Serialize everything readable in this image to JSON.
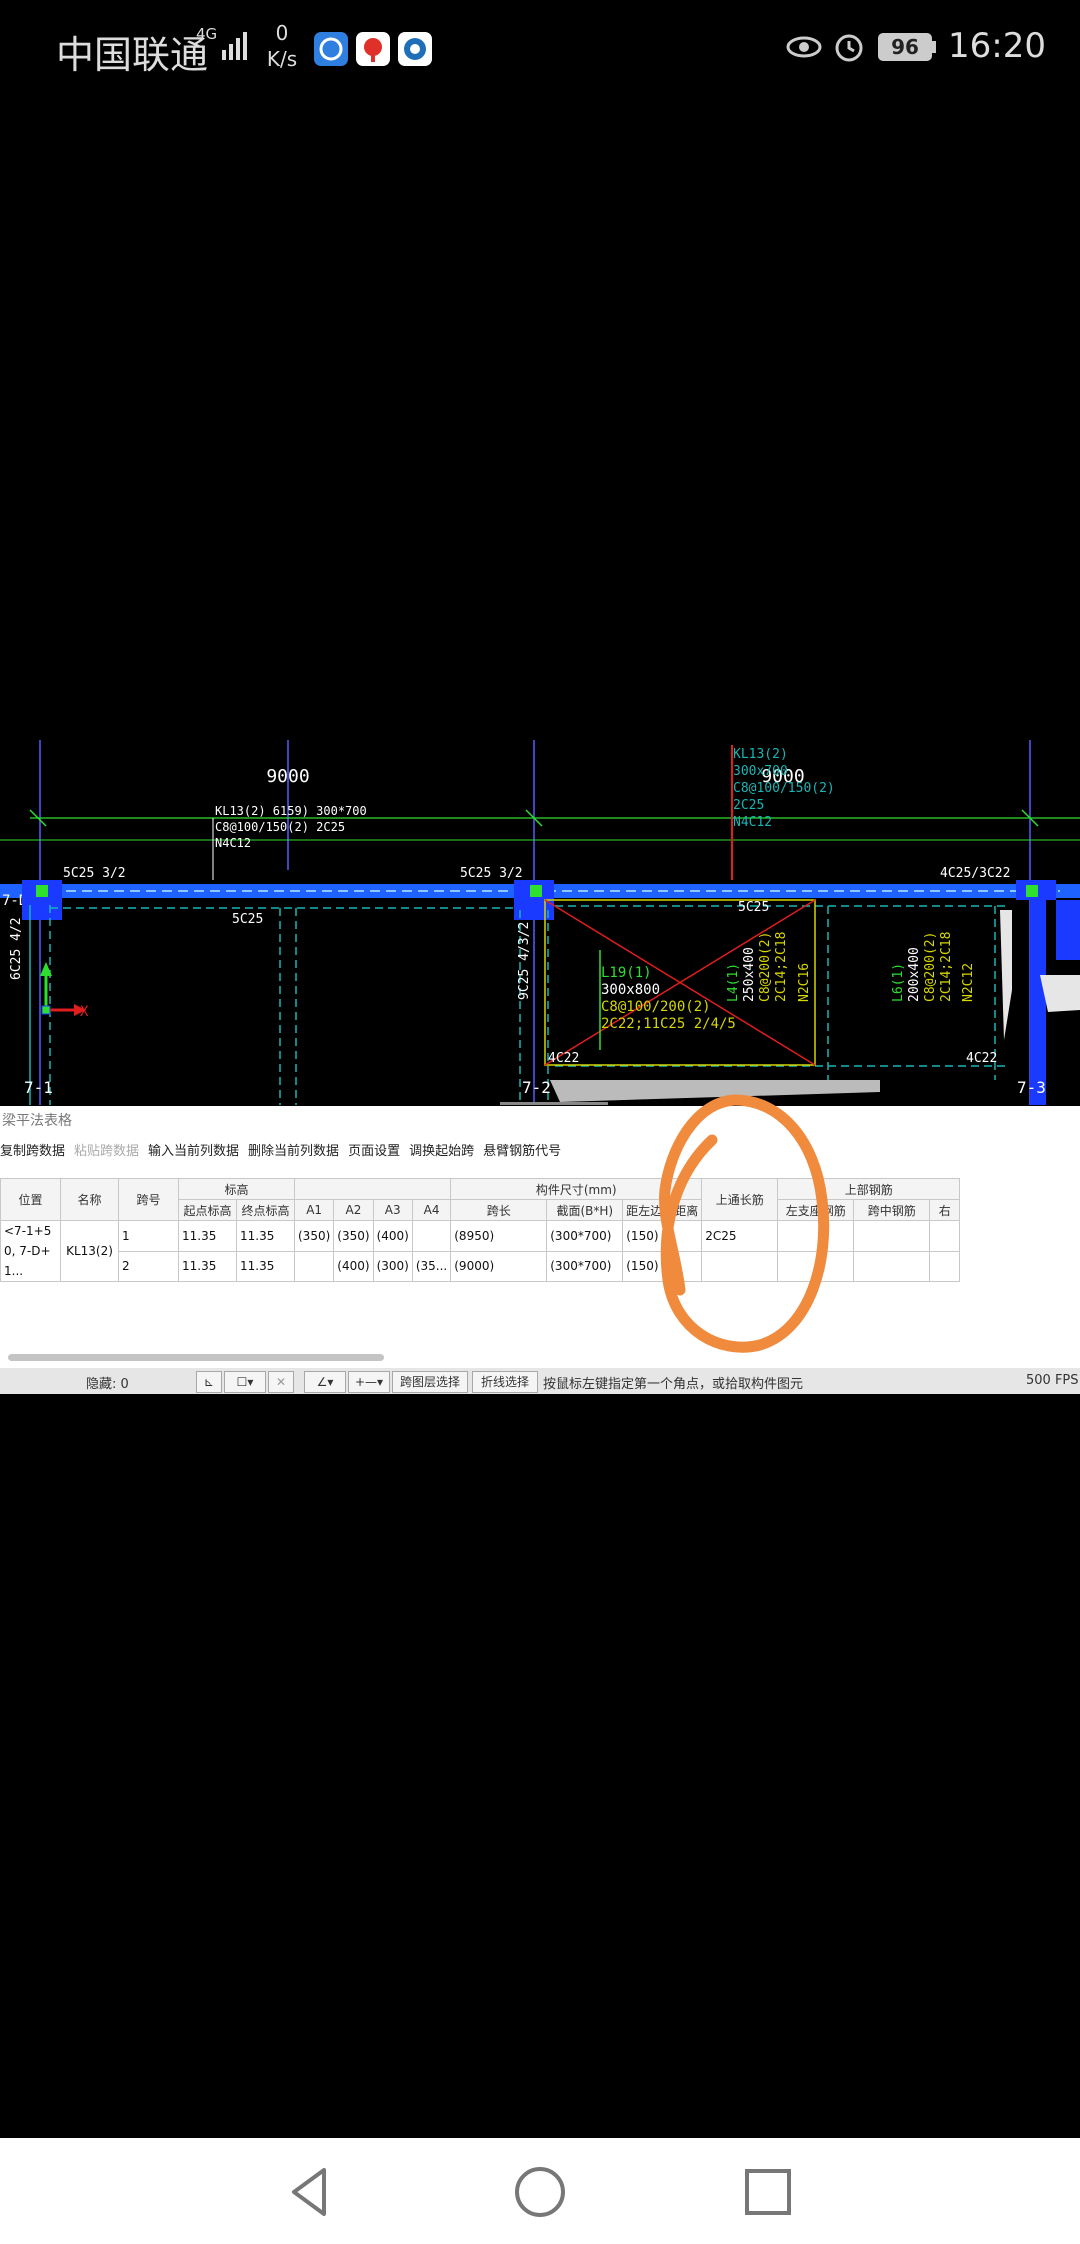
{
  "status_bar": {
    "carrier": "中国联通",
    "network": "4G",
    "speed_value": "0",
    "speed_unit": "K/s",
    "battery": "96",
    "time": "16:20"
  },
  "cad": {
    "top_span_1": "9000",
    "top_span_2": "9000",
    "beam_note_1": "KL13(2) 6159) 300*700",
    "beam_note_2": "C8@100/150(2) 2C25",
    "beam_note_3": "N4C12",
    "green_note_1": "KL13(2)",
    "green_note_2": "300x700",
    "green_note_3": "C8@100/150(2)",
    "green_note_4": "2C25",
    "green_note_5": "N4C12",
    "left_label": "7-D",
    "rebar_top_1": "5C25 3/2",
    "rebar_top_2": "5C25 3/2",
    "rebar_top_3": "4C25/3C22",
    "rebar_bot_1": "5C25",
    "rebar_bot_2": "5C25",
    "side_rebar_1": "6C25 4/2",
    "side_rebar_2": "9C25 4/3/2",
    "l19_1": "L19(1)",
    "l19_2": "300x800",
    "l19_3": "C8@100/200(2)",
    "l19_4": "2C22;11C25 2/4/5",
    "l4_1": "L4(1)",
    "l4_2": "250x400",
    "l4_3": "C8@200(2)",
    "l4_4": "2C14;2C18",
    "l4_5": "N2C16",
    "l6_1": "L6(1)",
    "l6_2": "200x400",
    "l6_3": "C8@200(2)",
    "l6_4": "2C14;2C18",
    "l6_5": "N2C12",
    "corner_1": "4C22",
    "corner_2": "4C22",
    "axis_x": "X",
    "axis_1": "7-1",
    "axis_2": "7-2",
    "axis_3": "7-3"
  },
  "panel": {
    "title": "梁平法表格",
    "toolbar": [
      {
        "label": "复制跨数据",
        "enabled": true
      },
      {
        "label": "粘贴跨数据",
        "enabled": false
      },
      {
        "label": "输入当前列数据",
        "enabled": true
      },
      {
        "label": "删除当前列数据",
        "enabled": true
      },
      {
        "label": "页面设置",
        "enabled": true
      },
      {
        "label": "调换起始跨",
        "enabled": true
      },
      {
        "label": "悬臂钢筋代号",
        "enabled": true
      }
    ],
    "headers": {
      "position": "位置",
      "name": "名称",
      "span_no": "跨号",
      "elevation": "标高",
      "start_elev": "起点标高",
      "end_elev": "终点标高",
      "a1": "A1",
      "a2": "A2",
      "a3": "A3",
      "a4": "A4",
      "dims": "构件尺寸(mm)",
      "span_len": "跨长",
      "section": "截面(B*H)",
      "edge_dist": "距左边线距离",
      "through_bar": "上通长筋",
      "top_rebar": "上部钢筋",
      "left_support": "左支座钢筋",
      "mid_span": "跨中钢筋",
      "right": "右"
    },
    "merged": {
      "position": "<7-1+50, 7-D+1...",
      "name": "KL13(2)",
      "through_bar": "2C25"
    },
    "rows": [
      {
        "span": "1",
        "start": "11.35",
        "end": "11.35",
        "a1": "(350)",
        "a2": "(350)",
        "a3": "(400)",
        "a4": "",
        "span_len": "(8950)",
        "section": "(300*700)",
        "edge": "(150)"
      },
      {
        "span": "2",
        "start": "11.35",
        "end": "11.35",
        "a1": "",
        "a2": "(400)",
        "a3": "(300)",
        "a4": "(35...",
        "span_len": "(9000)",
        "section": "(300*700)",
        "edge": "(150)"
      }
    ]
  },
  "app_status": {
    "hidden_label": "隐藏: 0",
    "btn_span_select": "跨图层选择",
    "btn_polyline_select": "折线选择",
    "prompt": "按鼠标左键指定第一个角点，或拾取构件图元",
    "fps": "500 FPS"
  },
  "colors": {
    "beam_blue": "#1e63ff",
    "column_blue": "#1a3aff",
    "cad_green": "#2ee02e",
    "cad_teal": "#19b5b5",
    "cad_yellow": "#d6d600",
    "cad_red": "#e01e1e",
    "annotation_orange": "#f08a3c"
  }
}
